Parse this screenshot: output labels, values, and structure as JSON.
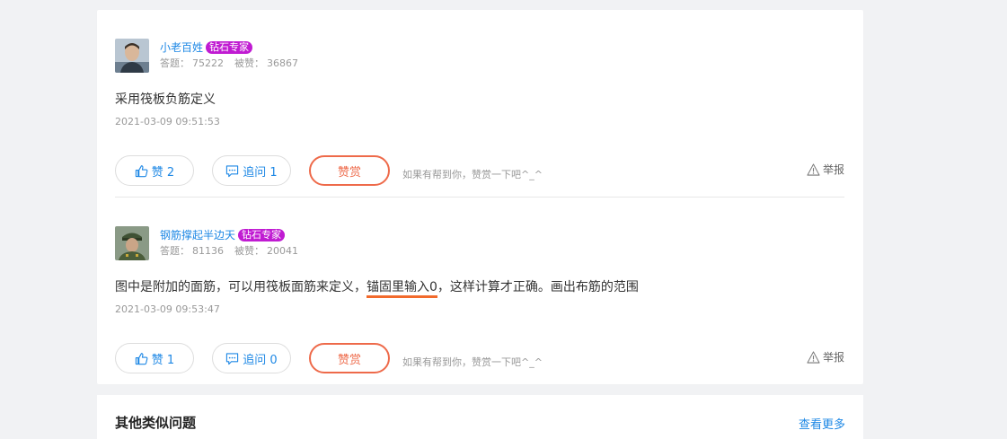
{
  "answers": [
    {
      "username": "小老百姓",
      "badge": "钻石专家",
      "answers_label": "答题：",
      "answers_count": "75222",
      "likes_label": "被赞：",
      "likes_count": "36867",
      "content_before": "采用筏板负筋定义",
      "content_highlight": "",
      "content_after": "",
      "time": "2021-03-09 09:51:53",
      "like_label": "赞 2",
      "ask_label": "追问  1",
      "reward_label": "赞赏",
      "hint": "如果有帮到你，赞赏一下吧^_^",
      "report_label": "举报"
    },
    {
      "username": "钢筋撑起半边天",
      "badge": "钻石专家",
      "answers_label": "答题：",
      "answers_count": "81136",
      "likes_label": "被赞：",
      "likes_count": "20041",
      "content_before": "图中是附加的面筋，可以用筏板面筋来定义，",
      "content_highlight": "锚固里输入0",
      "content_after": "，这样计算才正确。画出布筋的范围",
      "time": "2021-03-09 09:53:47",
      "like_label": "赞 1",
      "ask_label": "追问  0",
      "reward_label": "赞赏",
      "hint": "如果有帮到你，赞赏一下吧^_^",
      "report_label": "举报"
    }
  ],
  "similar": {
    "title": "其他类似问题",
    "more_label": "查看更多"
  },
  "colors": {
    "link": "#1e88e5",
    "badge": "#c01bd2",
    "reward": "#ee6a4a",
    "highlight_underline": "#f26a2c"
  }
}
